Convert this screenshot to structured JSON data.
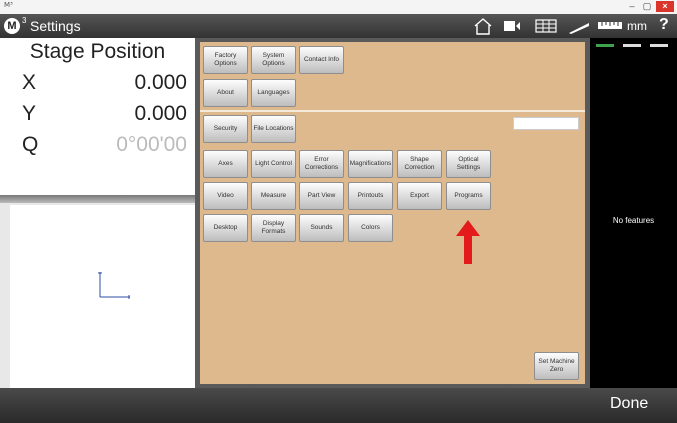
{
  "window": {
    "app_label": "M³"
  },
  "header": {
    "logo": "M",
    "logo_sup": "3",
    "title": "Settings",
    "units": "mm",
    "help": "?"
  },
  "dro": {
    "title": "Stage Position",
    "rows": [
      {
        "label": "X",
        "value": "0.000"
      },
      {
        "label": "Y",
        "value": "0.000"
      },
      {
        "label": "Q",
        "value": "0°00'00"
      }
    ]
  },
  "settings": {
    "buttons": [
      {
        "label": "Factory Options"
      },
      {
        "label": "System Options"
      },
      {
        "label": "Contact Info"
      },
      {
        "label": "About"
      },
      {
        "label": "Languages"
      },
      {
        "label": "Security"
      },
      {
        "label": "File Locations"
      },
      {
        "label": "Axes"
      },
      {
        "label": "Light Control"
      },
      {
        "label": "Error Corrections"
      },
      {
        "label": "Magnifications"
      },
      {
        "label": "Shape Correction"
      },
      {
        "label": "Optical Settings"
      },
      {
        "label": "Video"
      },
      {
        "label": "Measure"
      },
      {
        "label": "Part View"
      },
      {
        "label": "Printouts"
      },
      {
        "label": "Export"
      },
      {
        "label": "Programs"
      },
      {
        "label": "Desktop"
      },
      {
        "label": "Display Formats"
      },
      {
        "label": "Sounds"
      },
      {
        "label": "Colors"
      },
      {
        "label": "Set Machine Zero"
      }
    ]
  },
  "feature_list": {
    "empty_text": "No features"
  },
  "footer": {
    "done_label": "Done"
  },
  "colors": {
    "panel": "#ddb98d",
    "arrow": "#e31b1b",
    "close": "#d9352a"
  }
}
